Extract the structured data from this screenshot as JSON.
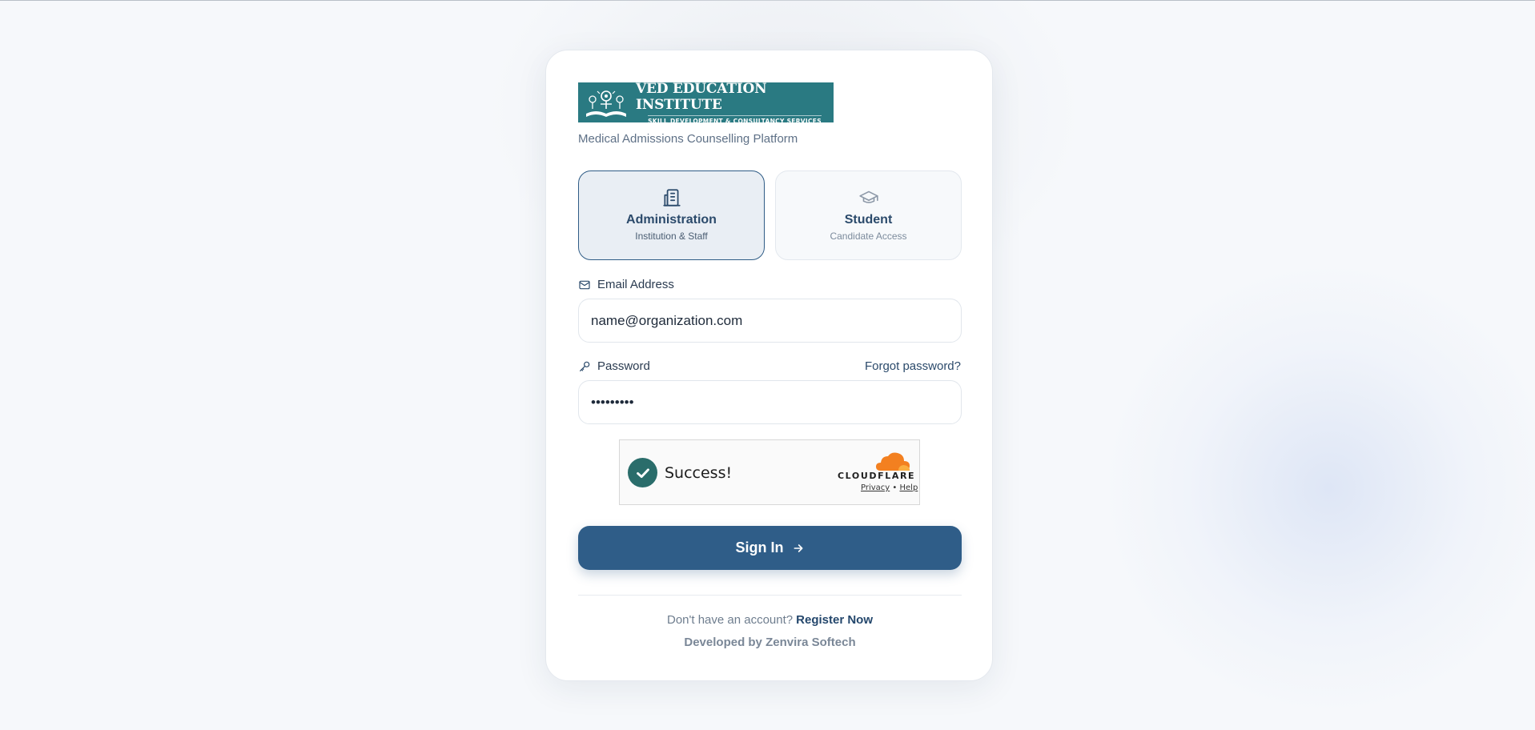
{
  "brand": {
    "logo_line1": "VED EDUCATION INSTITUTE",
    "logo_line2": "SKILL DEVELOPMENT & CONSULTANCY SERVICES",
    "tagline": "Medical Admissions Counselling Platform"
  },
  "roles": [
    {
      "title": "Administration",
      "subtitle": "Institution & Staff",
      "icon": "building-icon",
      "selected": true
    },
    {
      "title": "Student",
      "subtitle": "Candidate Access",
      "icon": "graduation-cap-icon",
      "selected": false
    }
  ],
  "form": {
    "email_label": "Email Address",
    "email_value": "name@organization.com",
    "password_label": "Password",
    "password_value": "•••••••••",
    "forgot_label": "Forgot password?",
    "signin_label": "Sign In"
  },
  "captcha": {
    "status": "Success!",
    "provider": "CLOUDFLARE",
    "privacy": "Privacy",
    "separator": "•",
    "help": "Help"
  },
  "footer": {
    "register_prompt": "Don't have an account?",
    "register_link": "Register Now",
    "developer": "Developed by Zenvira Softech"
  },
  "colors": {
    "primary": "#2f5d88",
    "logo_bg": "#2a7a82",
    "captcha_check": "#2a6d6b",
    "cloudflare_orange": "#f38020"
  }
}
